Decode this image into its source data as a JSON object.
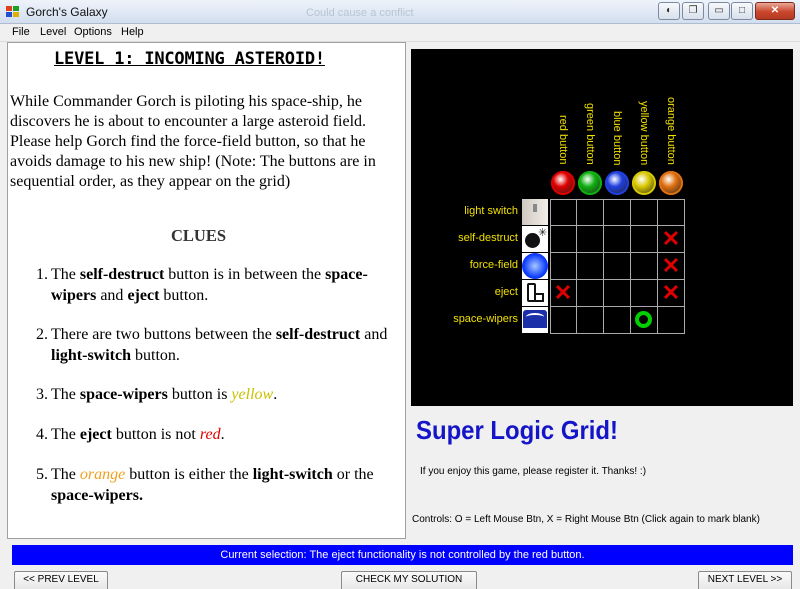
{
  "window": {
    "title": "Gorch's Galaxy",
    "background_title": "Could cause a conflict"
  },
  "menu": [
    "File",
    "Level",
    "Options",
    "Help"
  ],
  "left": {
    "level_title": "LEVEL 1: INCOMING ASTEROID!",
    "intro": "While Commander Gorch is piloting his space-ship, he discovers he is about to encounter a large asteroid field. Please help Gorch find the force-field button, so that he avoids damage to his new ship! (Note: The buttons are in sequential order, as they appear on the grid)",
    "clues_heading": "CLUES",
    "clues": [
      {
        "number": "1.",
        "parts": [
          {
            "t": "The ",
            "s": ""
          },
          {
            "t": "self-destruct",
            "s": "b"
          },
          {
            "t": " button is in between the ",
            "s": ""
          },
          {
            "t": "space-wipers",
            "s": "b"
          },
          {
            "t": " and ",
            "s": ""
          },
          {
            "t": "eject",
            "s": "b"
          },
          {
            "t": " button.",
            "s": ""
          }
        ]
      },
      {
        "number": "2.",
        "parts": [
          {
            "t": "There are two buttons between the ",
            "s": ""
          },
          {
            "t": "self-destruct",
            "s": "b"
          },
          {
            "t": " and ",
            "s": ""
          },
          {
            "t": "light-switch",
            "s": "b"
          },
          {
            "t": " button.",
            "s": ""
          }
        ]
      },
      {
        "number": "3.",
        "parts": [
          {
            "t": "The ",
            "s": ""
          },
          {
            "t": "space-wipers",
            "s": "b"
          },
          {
            "t": " button is ",
            "s": ""
          },
          {
            "t": "yellow",
            "s": "yellow"
          },
          {
            "t": ".",
            "s": ""
          }
        ]
      },
      {
        "number": "4.",
        "parts": [
          {
            "t": "The ",
            "s": ""
          },
          {
            "t": "eject",
            "s": "b"
          },
          {
            "t": " button is not ",
            "s": ""
          },
          {
            "t": "red",
            "s": "red"
          },
          {
            "t": ".",
            "s": ""
          }
        ]
      },
      {
        "number": "5.",
        "parts": [
          {
            "t": "The ",
            "s": ""
          },
          {
            "t": "orange",
            "s": "orange"
          },
          {
            "t": " button is either the ",
            "s": ""
          },
          {
            "t": "light-switch",
            "s": "b"
          },
          {
            "t": " or the ",
            "s": ""
          },
          {
            "t": "space-wipers.",
            "s": "b"
          }
        ]
      }
    ]
  },
  "grid": {
    "columns": [
      {
        "label": "red button",
        "color": "#e00000"
      },
      {
        "label": "green button",
        "color": "#10b010"
      },
      {
        "label": "blue button",
        "color": "#2040e0"
      },
      {
        "label": "yellow button",
        "color": "#d8c800"
      },
      {
        "label": "orange button",
        "color": "#e07010"
      }
    ],
    "rows": [
      {
        "label": "light switch",
        "icon": "light-switch-icon"
      },
      {
        "label": "self-destruct",
        "icon": "bomb-icon"
      },
      {
        "label": "force-field",
        "icon": "force-field-icon"
      },
      {
        "label": "eject",
        "icon": "eject-seat-icon"
      },
      {
        "label": "space-wipers",
        "icon": "space-wipers-icon"
      }
    ],
    "marks": [
      [
        "",
        "",
        "",
        "",
        ""
      ],
      [
        "",
        "",
        "",
        "",
        "X"
      ],
      [
        "",
        "",
        "",
        "",
        "X"
      ],
      [
        "X",
        "",
        "",
        "",
        "X"
      ],
      [
        "",
        "",
        "",
        "O",
        ""
      ]
    ]
  },
  "right": {
    "brand": "Super Logic Grid!",
    "register": "If you enjoy this game, please register it. Thanks! :)",
    "controls": "Controls:  O = Left Mouse Btn,    X = Right Mouse Btn  (Click again to mark blank)"
  },
  "status": "Current selection: The eject functionality is not controlled by the red button.",
  "buttons": {
    "prev": "<< PREV LEVEL",
    "check": "CHECK MY SOLUTION",
    "next": "NEXT LEVEL >>"
  }
}
